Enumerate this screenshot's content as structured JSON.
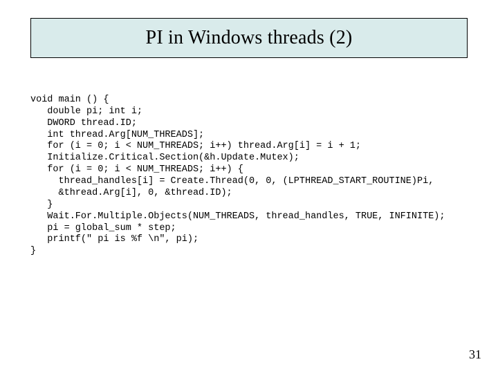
{
  "slide": {
    "title": "PI in Windows threads (2)",
    "page_number": "31"
  },
  "code": {
    "l01": "void main () {",
    "l02": "   double pi; int i;",
    "l03": "   DWORD thread.ID;",
    "l04": "   int thread.Arg[NUM_THREADS];",
    "l05": "   for (i = 0; i < NUM_THREADS; i++) thread.Arg[i] = i + 1;",
    "l06": "   Initialize.Critical.Section(&h.Update.Mutex);",
    "l07": "   for (i = 0; i < NUM_THREADS; i++) {",
    "l08": "     thread_handles[i] = Create.Thread(0, 0, (LPTHREAD_START_ROUTINE)Pi,",
    "l09": "     &thread.Arg[i], 0, &thread.ID);",
    "l10": "   }",
    "l11": "   Wait.For.Multiple.Objects(NUM_THREADS, thread_handles, TRUE, INFINITE);",
    "l12": "   pi = global_sum * step;",
    "l13": "   printf(\" pi is %f \\n\", pi);",
    "l14": "}"
  }
}
